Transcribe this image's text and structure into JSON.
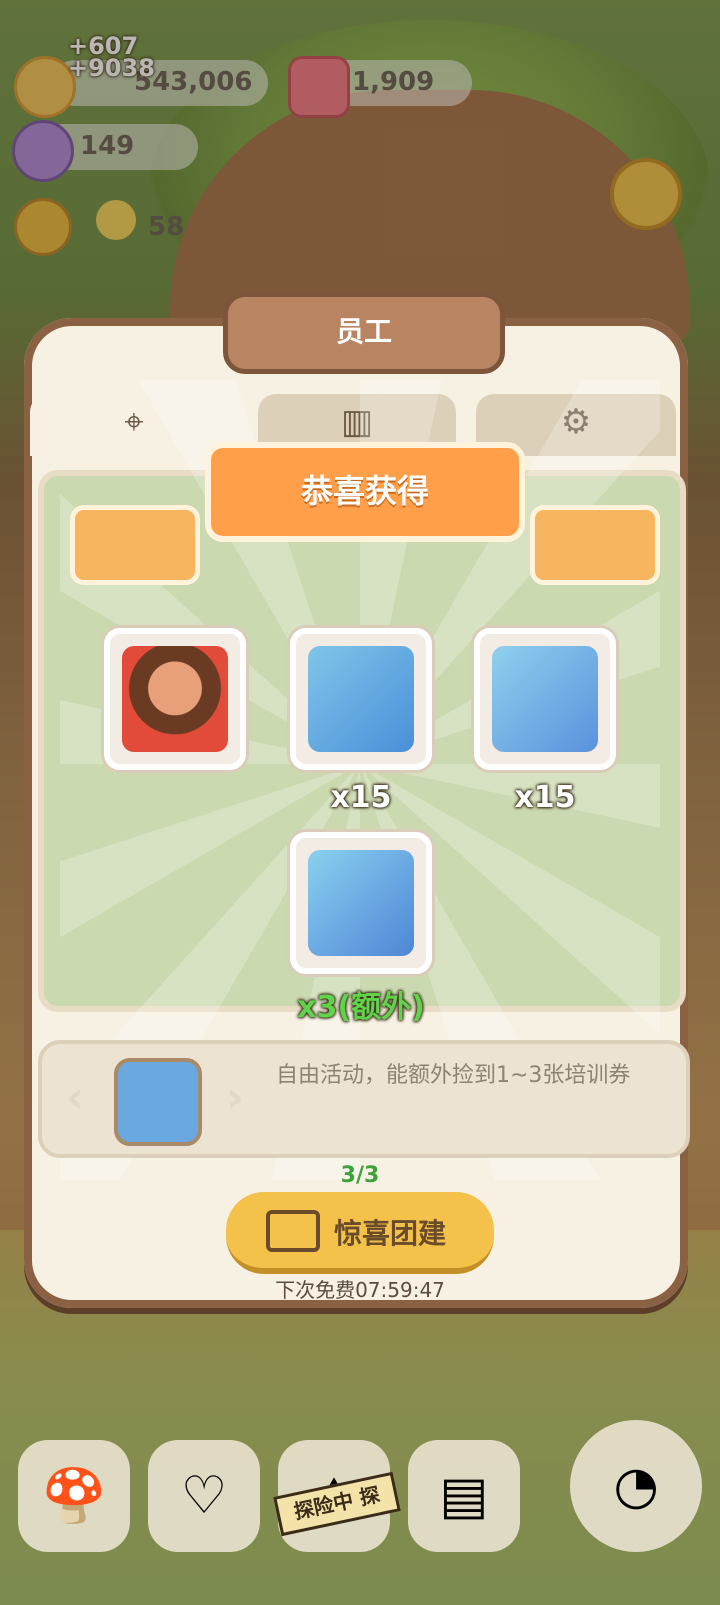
{
  "resources": {
    "coins": "543,006",
    "coins_gain_1": "+607",
    "coins_gain_2": "+9038",
    "gems": "1,909",
    "crystals": "149",
    "staff_count": "58"
  },
  "panel": {
    "title": "员工",
    "tabs": [
      {
        "icon": "location-pin-icon"
      },
      {
        "icon": "book-icon"
      },
      {
        "icon": "gear-cluster-icon"
      }
    ]
  },
  "reward": {
    "banner": "恭喜获得",
    "items": [
      {
        "name": "caveman-character",
        "qty": ""
      },
      {
        "name": "goggles-manual",
        "qty": "x15"
      },
      {
        "name": "spatula-manual",
        "qty": "x15"
      },
      {
        "name": "training-voucher-book",
        "qty": "x3(额外)"
      }
    ]
  },
  "activity": {
    "description": "自由活动，能额外捡到1~3张培训券",
    "counter": "3/3",
    "button_label": "惊喜团建",
    "next_free": "下次免费07:59:47"
  },
  "nav": {
    "expedition_tag": "探险中 探"
  },
  "colors": {
    "banner": "#ff9f4a",
    "button": "#f4c24b",
    "counter_green": "#3ea23a",
    "extra_green": "#5fd44a"
  }
}
